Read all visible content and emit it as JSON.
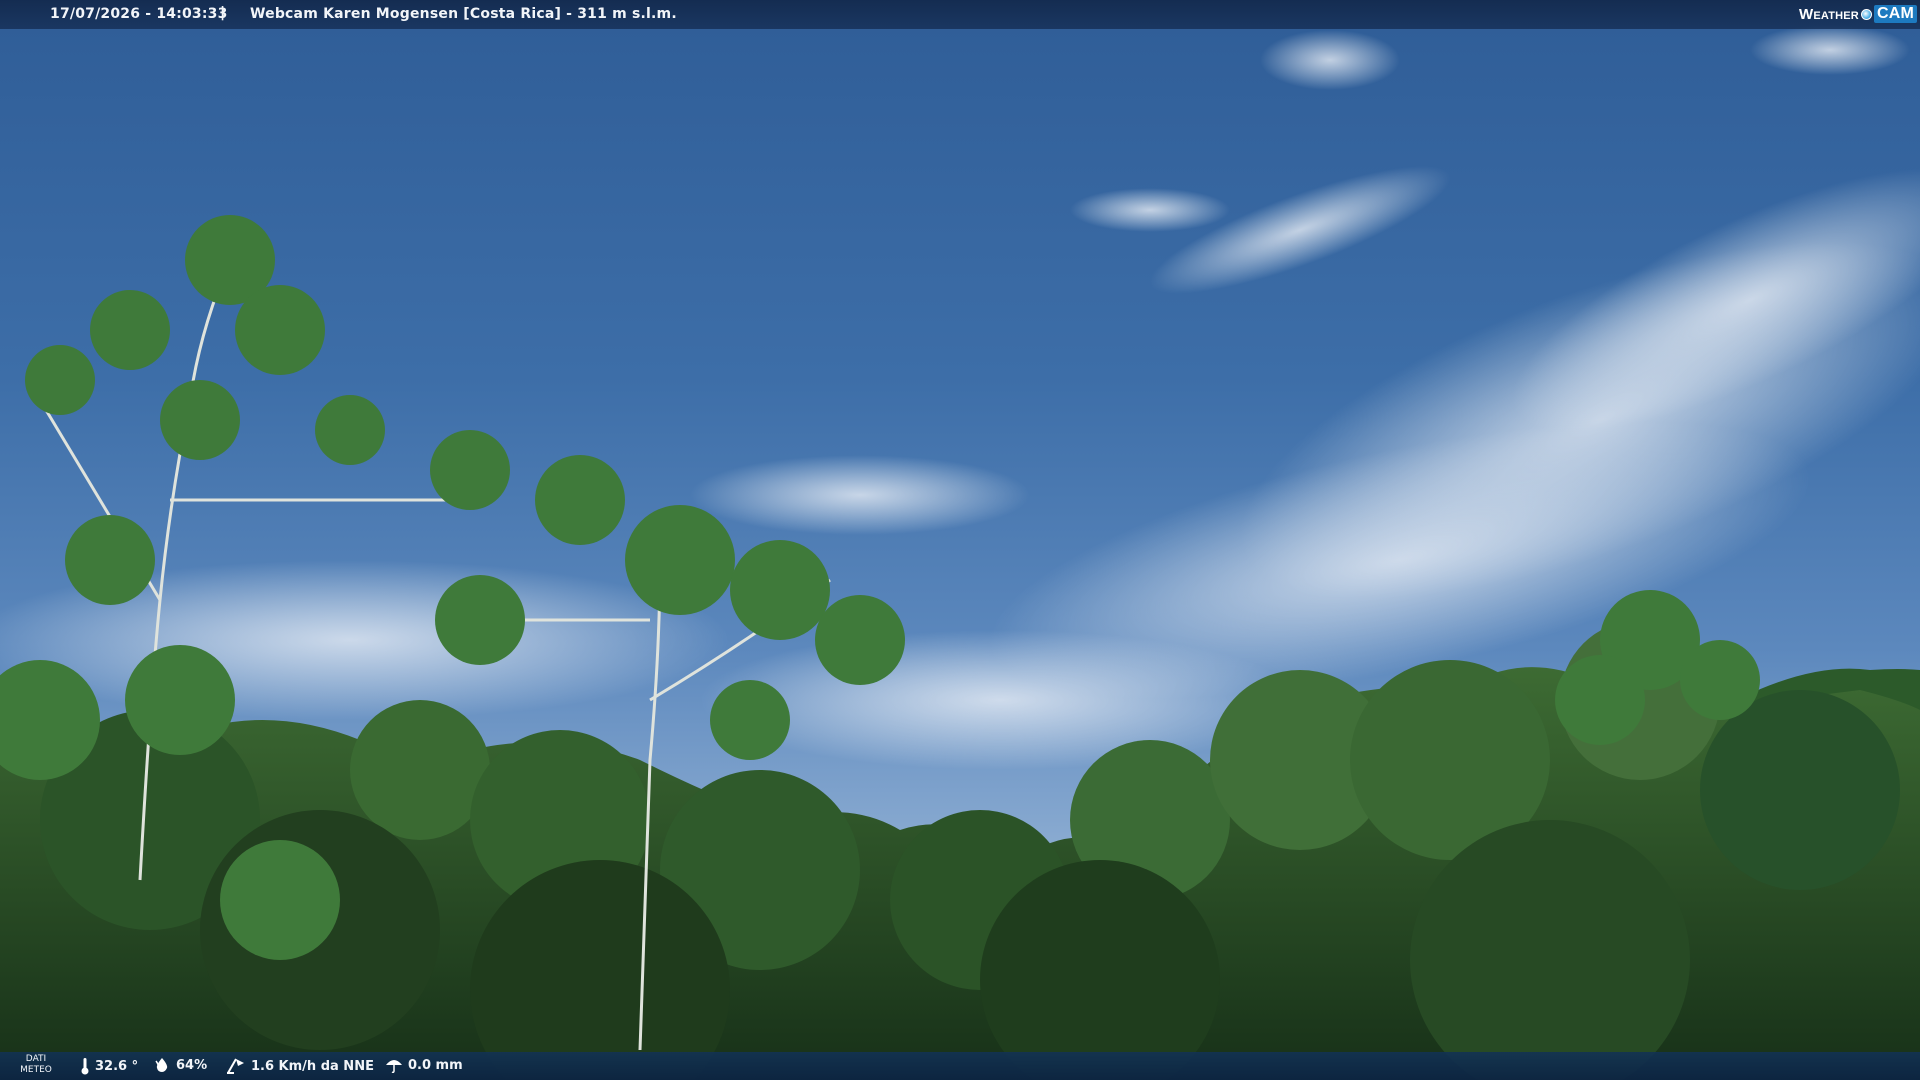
{
  "header": {
    "datetime": "17/07/2026 - 14:03:33",
    "separator": "|",
    "title": "Webcam Karen Mogensen [Costa Rica] - 311 m s.l.m."
  },
  "logo": {
    "weather": "Weather",
    "cam": "CAM"
  },
  "footer": {
    "label_line1": "DATI",
    "label_line2": "METEO",
    "temperature": "32.6 °",
    "humidity": "64%",
    "wind": "1.6 Km/h da NNE",
    "rain": "0.0 mm"
  },
  "icons": {
    "temperature": "thermometer-icon",
    "humidity": "humidity-drop-icon",
    "wind": "wind-icon",
    "rain": "rain-umbrella-icon"
  }
}
